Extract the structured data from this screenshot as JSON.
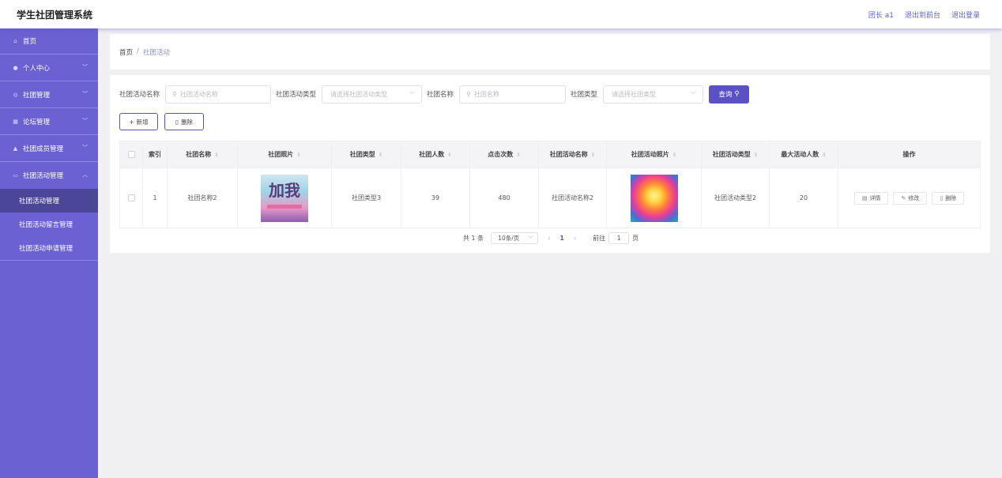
{
  "header": {
    "title": "学生社团管理系统",
    "user": "团长 a1",
    "front_link": "退出到前台",
    "logout_link": "退出登录"
  },
  "sidebar": {
    "items": [
      {
        "label": "首页",
        "icon": "home-icon"
      },
      {
        "label": "个人中心",
        "icon": "user-icon"
      },
      {
        "label": "社团管理",
        "icon": "club-icon"
      },
      {
        "label": "论坛管理",
        "icon": "forum-icon"
      },
      {
        "label": "社团成员管理",
        "icon": "member-icon"
      },
      {
        "label": "社团活动管理",
        "icon": "activity-icon"
      }
    ],
    "sub_items": [
      {
        "label": "社团活动管理",
        "active": true
      },
      {
        "label": "社团活动留言管理",
        "active": false
      },
      {
        "label": "社团活动申请管理",
        "active": false
      }
    ]
  },
  "breadcrumb": {
    "home": "首页",
    "sep": "/",
    "current": "社团活动"
  },
  "search": {
    "activity_name_label": "社团活动名称",
    "activity_name_placeholder": "社团活动名称",
    "activity_type_label": "社团活动类型",
    "activity_type_placeholder": "请选择社团活动类型",
    "club_name_label": "社团名称",
    "club_name_placeholder": "社团名称",
    "club_type_label": "社团类型",
    "club_type_placeholder": "请选择社团类型",
    "query_label": "查询"
  },
  "actions": {
    "add_label": "新增",
    "delete_label": "删除"
  },
  "table": {
    "headers": {
      "index": "索引",
      "club_name": "社团名称",
      "club_photo": "社团照片",
      "club_type": "社团类型",
      "club_members": "社团人数",
      "clicks": "点击次数",
      "activity_name": "社团活动名称",
      "activity_photo": "社团活动照片",
      "activity_type": "社团活动类型",
      "max_people": "最大活动人数",
      "ops": "操作"
    },
    "rows": [
      {
        "index": "1",
        "club_name": "社团名称2",
        "club_type": "社团类型3",
        "club_members": "39",
        "clicks": "480",
        "activity_name": "社团活动名称2",
        "activity_type": "社团活动类型2",
        "max_people": "20"
      }
    ],
    "row_ops": {
      "detail": "详情",
      "edit": "修改",
      "delete": "删除"
    }
  },
  "pagination": {
    "total": "共 1 条",
    "page_size": "10条/页",
    "current_page": "1",
    "goto_label": "前往",
    "goto_value": "1",
    "page_suffix": "页"
  },
  "colors": {
    "accent": "#5a52c4",
    "sidebar": "#6a62d3",
    "sidebar_active": "#4c4699"
  }
}
